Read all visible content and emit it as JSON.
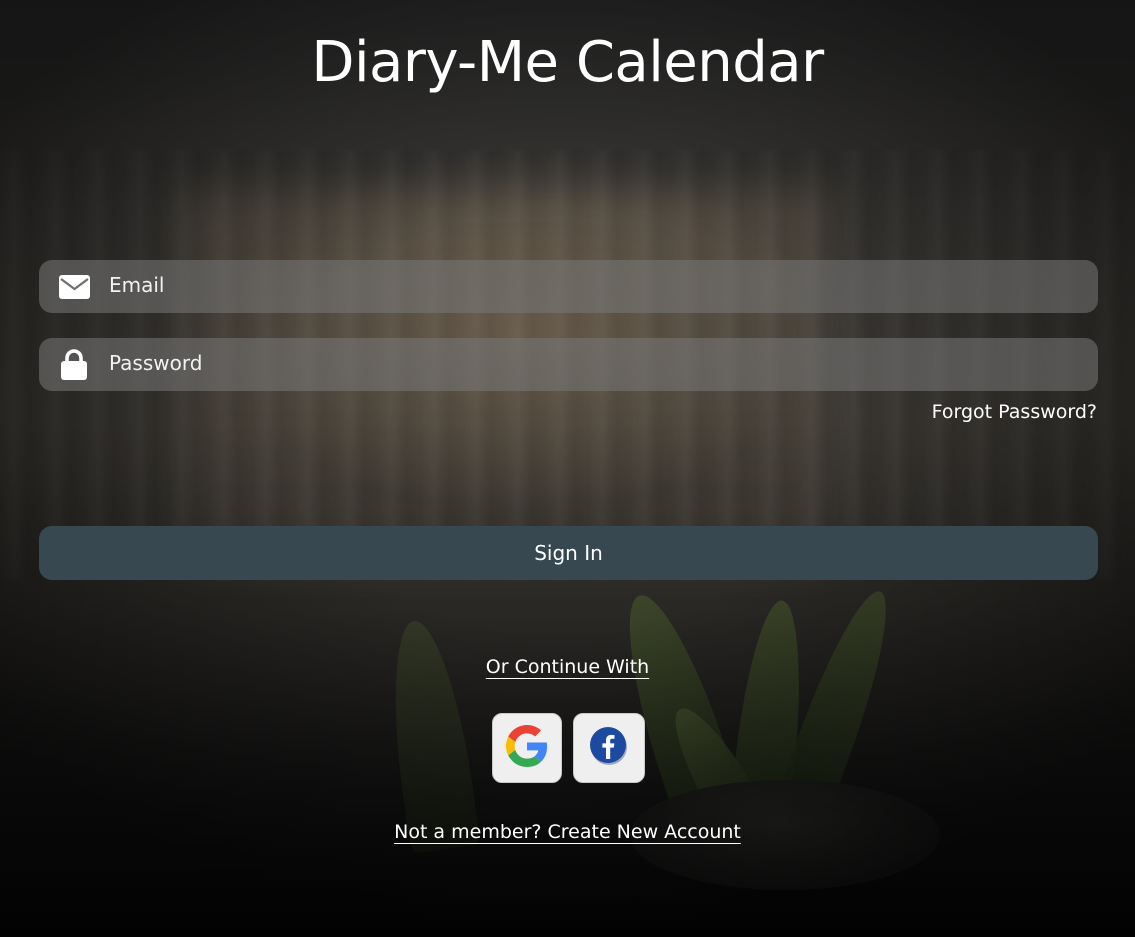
{
  "app": {
    "title": "Diary-Me Calendar"
  },
  "form": {
    "email": {
      "placeholder": "Email",
      "value": "",
      "icon": "envelope-icon"
    },
    "password": {
      "placeholder": "Password",
      "value": "",
      "icon": "lock-icon"
    },
    "forgot_label": "Forgot Password?",
    "signin_label": "Sign In"
  },
  "social": {
    "heading": "Or Continue With",
    "providers": [
      {
        "name": "Google",
        "icon": "google-icon"
      },
      {
        "name": "Facebook",
        "icon": "facebook-icon"
      }
    ]
  },
  "footer": {
    "create_account_label": "Not a member? Create New Account"
  },
  "colors": {
    "signin_button": "#374850",
    "input_background": "#787878",
    "text": "#ffffff",
    "facebook_blue": "#1c4aa1"
  }
}
